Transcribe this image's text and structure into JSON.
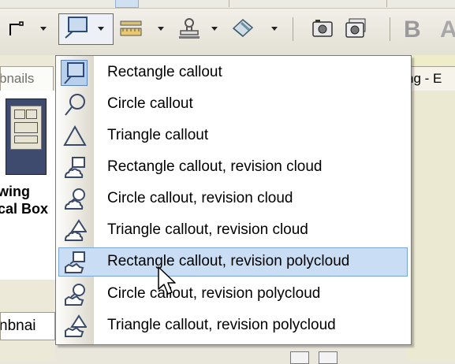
{
  "panels": {
    "thumbnails_title": "bnails",
    "thumbnail_caption_line1": "wing",
    "thumbnail_caption_line2": "cal Box",
    "thumbnails_title_2": "nbnai",
    "document_tab": "ng - E"
  },
  "toolbar": {
    "format_bold": "B",
    "format_letter": "A"
  },
  "menu": {
    "items": [
      {
        "label": "Rectangle callout",
        "icon": "rectangle-callout-icon"
      },
      {
        "label": "Circle callout",
        "icon": "circle-callout-icon"
      },
      {
        "label": "Triangle callout",
        "icon": "triangle-callout-icon"
      },
      {
        "label": "Rectangle callout, revision cloud",
        "icon": "rectangle-callout-cloud-icon"
      },
      {
        "label": "Circle callout, revision cloud",
        "icon": "circle-callout-cloud-icon"
      },
      {
        "label": "Triangle callout, revision cloud",
        "icon": "triangle-callout-cloud-icon"
      },
      {
        "label": "Rectangle callout, revision polycloud",
        "icon": "rectangle-callout-polycloud-icon",
        "highlighted": true
      },
      {
        "label": "Circle callout, revision polycloud",
        "icon": "circle-callout-polycloud-icon"
      },
      {
        "label": "Triangle callout, revision polycloud",
        "icon": "triangle-callout-polycloud-icon"
      }
    ]
  },
  "colors": {
    "highlight": "#c9def5",
    "highlight_border": "#7aa5d6",
    "icon_stroke": "#3a4a6a"
  }
}
